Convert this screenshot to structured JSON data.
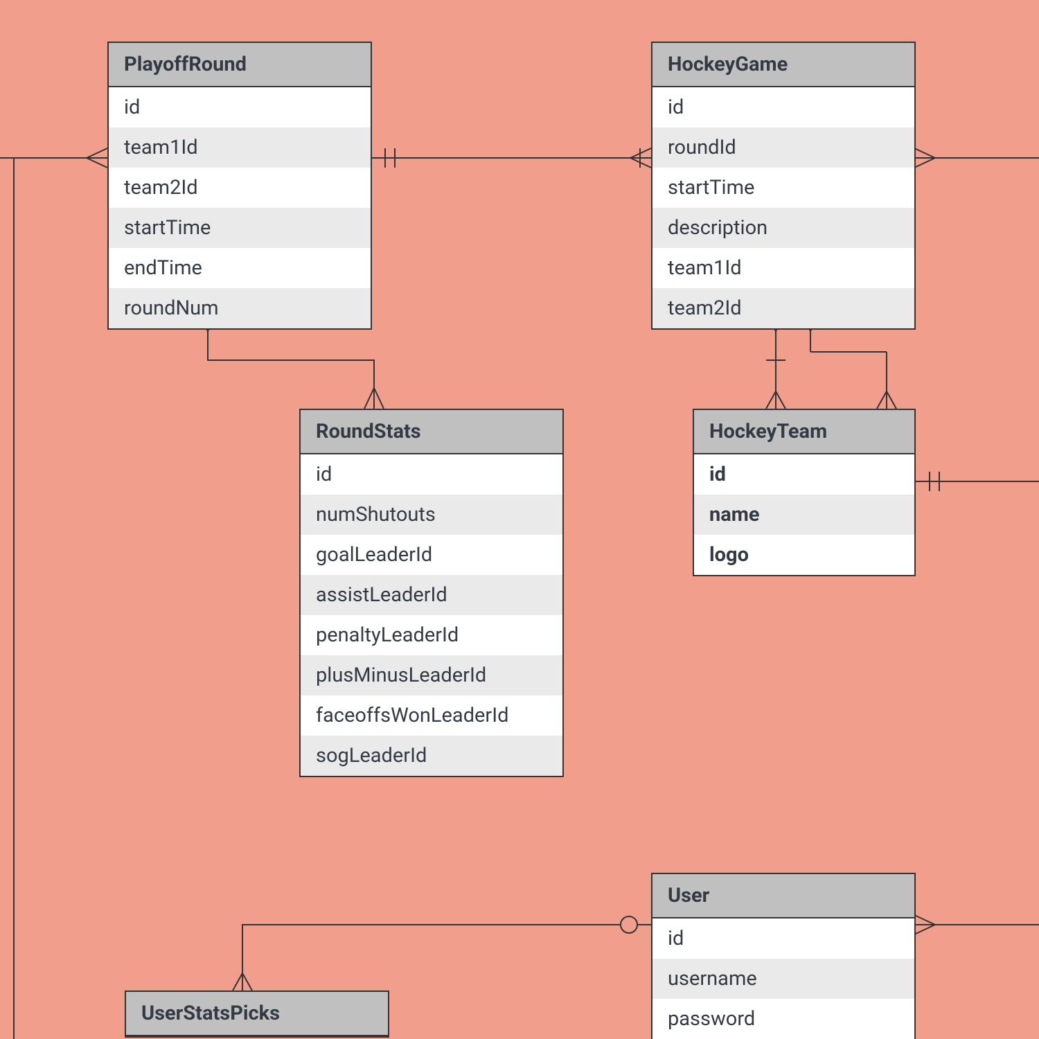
{
  "entities": {
    "playoffRound": {
      "title": "PlayoffRound",
      "fields": [
        "id",
        "team1Id",
        "team2Id",
        "startTime",
        "endTime",
        "roundNum"
      ]
    },
    "hockeyGame": {
      "title": "HockeyGame",
      "fields": [
        "id",
        "roundId",
        "startTime",
        "description",
        "team1Id",
        "team2Id"
      ]
    },
    "roundStats": {
      "title": "RoundStats",
      "fields": [
        "id",
        "numShutouts",
        "goalLeaderId",
        "assistLeaderId",
        "penaltyLeaderId",
        "plusMinusLeaderId",
        "faceoffsWonLeaderId",
        "sogLeaderId"
      ]
    },
    "hockeyTeam": {
      "title": "HockeyTeam",
      "fields": [
        "id",
        "name",
        "logo"
      ]
    },
    "user": {
      "title": "User",
      "fields": [
        "id",
        "username",
        "password"
      ]
    },
    "userStatsPicks": {
      "title": "UserStatsPicks"
    }
  },
  "colors": {
    "background": "#f19e8c",
    "headerFill": "#c0c0c0",
    "rowFill": "#ffffff",
    "rowAltFill": "#eaeaea",
    "stroke": "#333333"
  },
  "relationships": [
    {
      "from": "PlayoffRound",
      "to": "HockeyGame",
      "type": "one-to-many"
    },
    {
      "from": "HockeyGame",
      "to": "HockeyTeam",
      "type": "many-to-one"
    },
    {
      "from": "HockeyTeam",
      "to": "HockeyGame",
      "type": "one-to-many"
    },
    {
      "from": "PlayoffRound",
      "to": "RoundStats",
      "type": "one-to-many"
    },
    {
      "from": "User",
      "to": "UserStatsPicks",
      "type": "one-to-many (optional)"
    }
  ]
}
